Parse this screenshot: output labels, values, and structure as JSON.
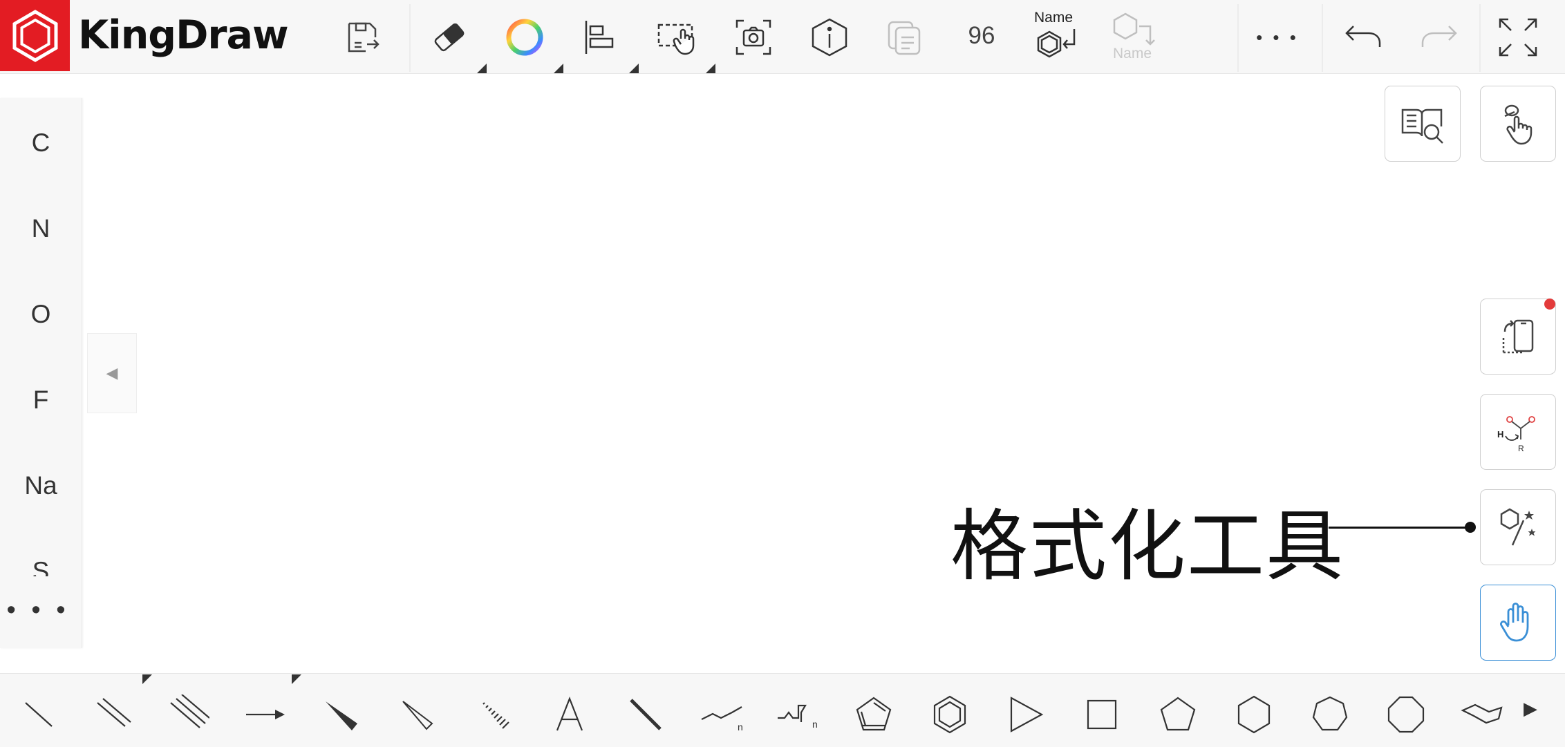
{
  "app": {
    "title": "KingDraw"
  },
  "toolbar": {
    "zoom": "96",
    "name_label": "Name",
    "name_label_disabled": "Name",
    "more": "• • •"
  },
  "elements": [
    "C",
    "N",
    "O",
    "F",
    "Na",
    "S"
  ],
  "elements_more": "• • •",
  "collapse_arrow": "◀",
  "callout": {
    "text": "格式化工具"
  },
  "bottom_more_arrow": "▶",
  "icons": {
    "top": [
      "logo-hexagon-icon",
      "save-icon",
      "eraser-icon",
      "color-wheel-icon",
      "align-icon",
      "select-icon",
      "screenshot-icon",
      "info-icon",
      "copy-icon",
      "name-to-structure-icon",
      "structure-to-name-icon",
      "more-icon",
      "undo-icon",
      "redo-icon",
      "fullscreen-icon"
    ],
    "right": [
      "book-search-icon",
      "hand-tap-icon",
      "rotate-device-icon",
      "reaction-mechanism-icon",
      "format-tool-icon",
      "hand-pan-icon"
    ],
    "bottom": [
      "single-bond-icon",
      "double-bond-icon",
      "triple-bond-icon",
      "arrow-icon",
      "wedge-bond-icon",
      "hollow-wedge-bond-icon",
      "hash-bond-icon",
      "text-icon",
      "bold-bond-icon",
      "chain-icon",
      "chain-n-icon",
      "cyclopentadiene-icon",
      "benzene-icon",
      "cyclopropane-icon",
      "cyclobutane-icon",
      "cyclopentane-icon",
      "cyclohexane-icon",
      "cycloheptane-icon",
      "cyclooctane-icon",
      "chair-cyclohexane-icon"
    ]
  },
  "colors": {
    "brand": "#e31c23",
    "active": "#3a8fd6",
    "badge": "#e33b3b"
  }
}
